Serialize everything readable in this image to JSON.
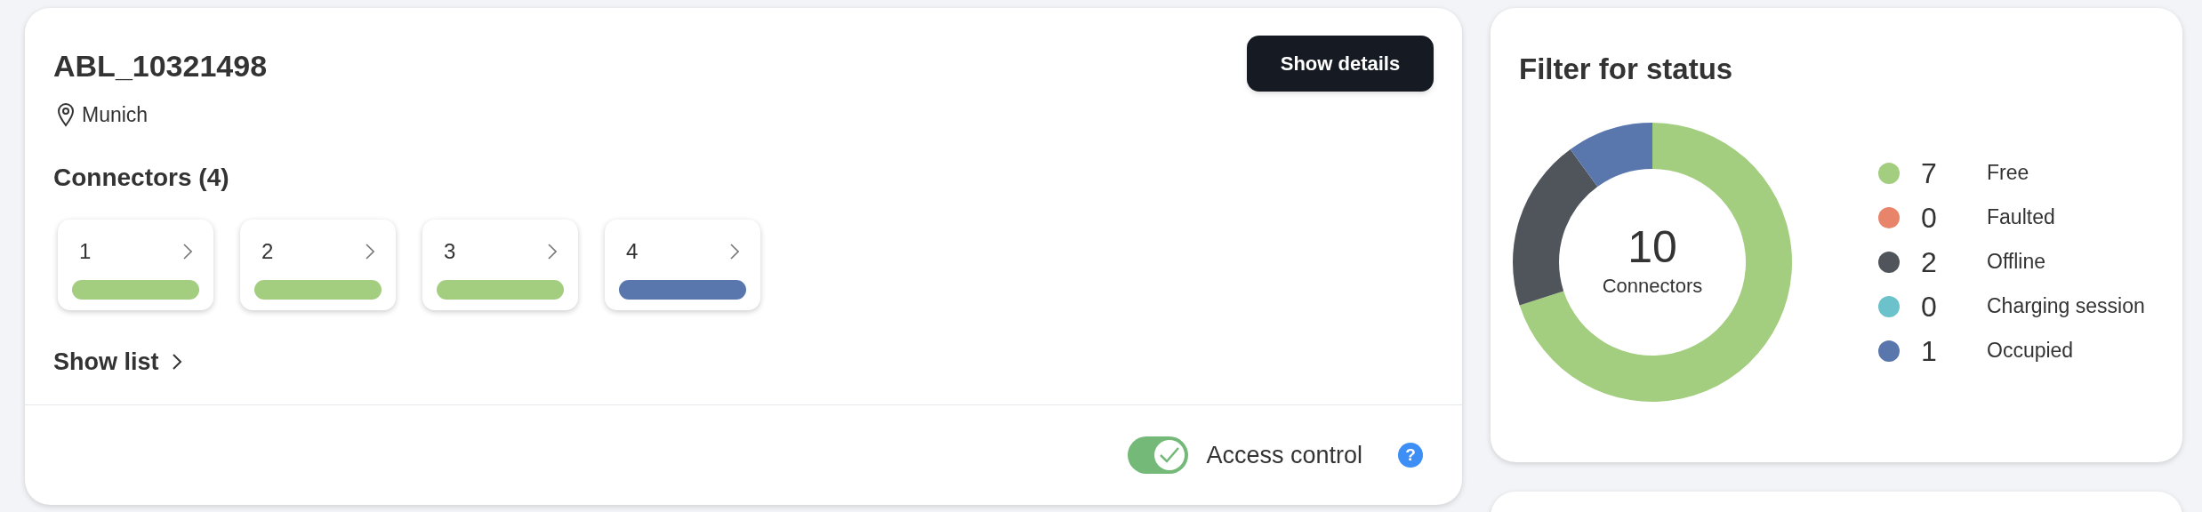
{
  "station": {
    "title": "ABL_10321498",
    "location": "Munich",
    "details_button": "Show details",
    "connectors_heading": "Connectors (4)",
    "connectors": [
      {
        "label": "1",
        "color": "#a3cd7f"
      },
      {
        "label": "2",
        "color": "#a3cd7f"
      },
      {
        "label": "3",
        "color": "#a3cd7f"
      },
      {
        "label": "4",
        "color": "#5a77ad"
      }
    ],
    "show_list": "Show list",
    "access_control": {
      "label": "Access control",
      "on": true
    },
    "help": "?"
  },
  "status_filter": {
    "title": "Filter for status",
    "center_value": "10",
    "center_label": "Connectors",
    "legend_counts": [
      "7",
      "0",
      "2",
      "0",
      "1"
    ],
    "chart_data": {
      "type": "donut",
      "categories": [
        "Free",
        "Faulted",
        "Offline",
        "Charging session",
        "Occupied"
      ],
      "values": [
        70,
        0,
        20,
        0,
        10
      ],
      "colors": [
        "#a3cd7f",
        "#e8846a",
        "#50545b",
        "#6cc2cb",
        "#5a77ad"
      ]
    }
  }
}
